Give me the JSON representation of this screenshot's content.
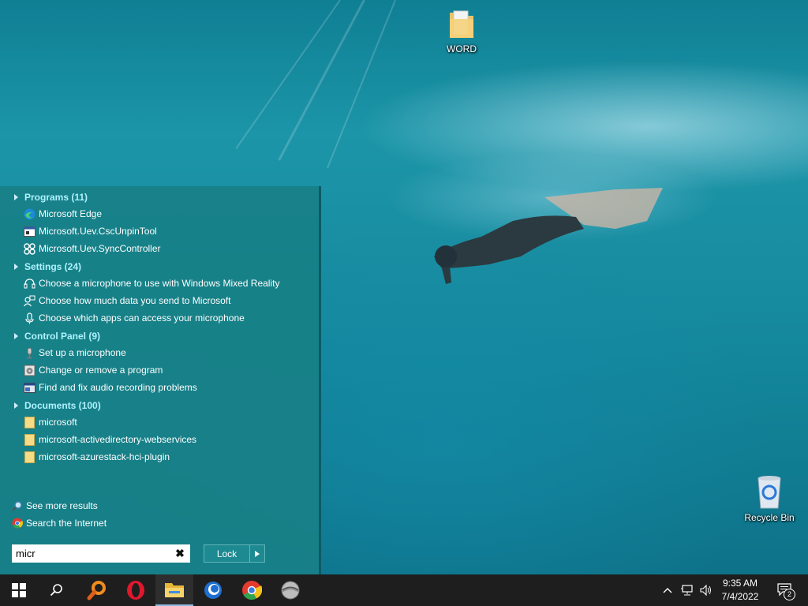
{
  "desktop": {
    "icons": [
      {
        "label": "WORD"
      },
      {
        "label": "Recycle Bin"
      }
    ]
  },
  "start_menu": {
    "groups": [
      {
        "header": "Programs (11)",
        "items": [
          "Microsoft Edge",
          "Microsoft.Uev.CscUnpinTool",
          "Microsoft.Uev.SyncController"
        ]
      },
      {
        "header": "Settings (24)",
        "items": [
          "Choose a microphone to use with Windows Mixed Reality",
          "Choose how much data you send to Microsoft",
          "Choose which apps can access your microphone"
        ]
      },
      {
        "header": "Control Panel (9)",
        "items": [
          "Set up a microphone",
          "Change or remove a program",
          "Find and fix audio recording problems"
        ]
      },
      {
        "header": "Documents (100)",
        "items": [
          "microsoft",
          "microsoft-activedirectory-webservices",
          "microsoft-azurestack-hci-plugin"
        ]
      }
    ],
    "see_more": "See more results",
    "search_internet": "Search the Internet",
    "search_value": "micr",
    "lock_label": "Lock"
  },
  "taskbar": {
    "time": "9:35 AM",
    "date": "7/4/2022",
    "notification_count": "2",
    "accent": "#8fb8e0"
  }
}
